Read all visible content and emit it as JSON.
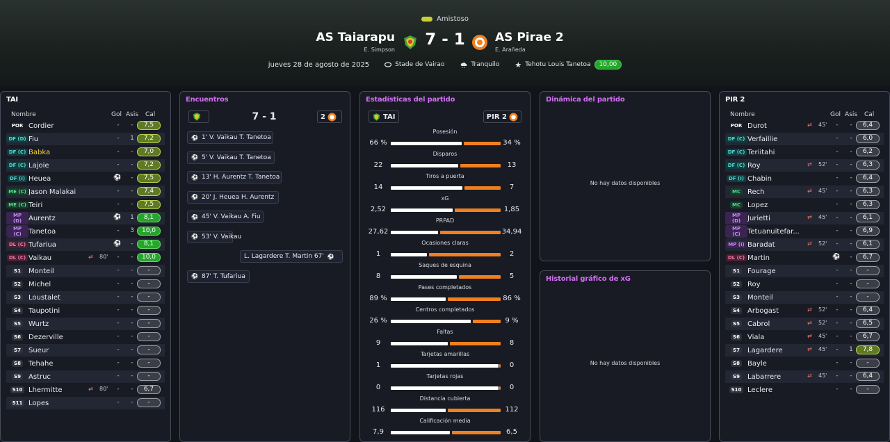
{
  "header": {
    "competition": "Amistoso",
    "home_team": "AS Taiarapu",
    "home_manager": "E. Simpson",
    "away_team": "AS Pirae 2",
    "away_manager": "E. Arañeda",
    "score": "7 - 1",
    "date": "jueves 28 de agosto de 2025",
    "stadium": "Stade de Vairao",
    "weather": "Tranquilo",
    "mvp": "Tehotu Louis Tanetoa",
    "mvp_rating": "10,00"
  },
  "home_panel": {
    "title": "TAI",
    "col_name": "Nombre",
    "col_goals": "Gol",
    "col_assists": "Asis",
    "col_rating": "Cal",
    "players": [
      {
        "pos": "POR",
        "name": "Cordier",
        "goals": "-",
        "assists": "-",
        "rating": "7,5",
        "sub": "",
        "ball": false
      },
      {
        "pos": "DF (D)",
        "name": "Fiu",
        "goals": "-",
        "assists": "1",
        "rating": "7,2",
        "sub": "",
        "ball": false
      },
      {
        "pos": "DF (C)",
        "name": "Babka",
        "goals": "-",
        "assists": "-",
        "rating": "7,0",
        "sub": "",
        "ball": false
      },
      {
        "pos": "DF (C)",
        "name": "Lajoie",
        "goals": "-",
        "assists": "-",
        "rating": "7,2",
        "sub": "",
        "ball": false
      },
      {
        "pos": "DF (I)",
        "name": "Heuea",
        "goals": "",
        "assists": "-",
        "rating": "7,5",
        "sub": "",
        "ball": true
      },
      {
        "pos": "ME (C)",
        "name": "Jason Malakai",
        "goals": "-",
        "assists": "-",
        "rating": "7,4",
        "sub": "",
        "ball": false
      },
      {
        "pos": "ME (C)",
        "name": "Teiri",
        "goals": "-",
        "assists": "-",
        "rating": "7,5",
        "sub": "",
        "ball": false
      },
      {
        "pos": "MP (D)",
        "name": "Aurentz",
        "goals": "",
        "assists": "1",
        "rating": "8,1",
        "sub": "",
        "ball": true
      },
      {
        "pos": "MP (C)",
        "name": "Tanetoa",
        "goals": "-",
        "assists": "3",
        "rating": "10,0",
        "sub": "",
        "ball": false
      },
      {
        "pos": "DL (C)",
        "name": "Tufariua",
        "goals": "",
        "assists": "-",
        "rating": "8,1",
        "sub": "",
        "ball": true
      },
      {
        "pos": "DL (C)",
        "name": "Vaikau",
        "goals": "-",
        "assists": "-",
        "rating": "10,0",
        "sub": "80'",
        "ball": false
      },
      {
        "pos": "S1",
        "name": "Monteil",
        "goals": "-",
        "assists": "-",
        "rating": "-",
        "sub": "",
        "ball": false
      },
      {
        "pos": "S2",
        "name": "Michel",
        "goals": "-",
        "assists": "-",
        "rating": "-",
        "sub": "",
        "ball": false
      },
      {
        "pos": "S3",
        "name": "Loustalet",
        "goals": "-",
        "assists": "-",
        "rating": "-",
        "sub": "",
        "ball": false
      },
      {
        "pos": "S4",
        "name": "Taupotini",
        "goals": "-",
        "assists": "-",
        "rating": "-",
        "sub": "",
        "ball": false
      },
      {
        "pos": "S5",
        "name": "Wurtz",
        "goals": "-",
        "assists": "-",
        "rating": "-",
        "sub": "",
        "ball": false
      },
      {
        "pos": "S6",
        "name": "Dezerville",
        "goals": "-",
        "assists": "-",
        "rating": "-",
        "sub": "",
        "ball": false
      },
      {
        "pos": "S7",
        "name": "Sueur",
        "goals": "-",
        "assists": "-",
        "rating": "-",
        "sub": "",
        "ball": false
      },
      {
        "pos": "S8",
        "name": "Tehahe",
        "goals": "-",
        "assists": "-",
        "rating": "-",
        "sub": "",
        "ball": false
      },
      {
        "pos": "S9",
        "name": "Astruc",
        "goals": "-",
        "assists": "-",
        "rating": "-",
        "sub": "",
        "ball": false
      },
      {
        "pos": "S10",
        "name": "Lhermitte",
        "goals": "-",
        "assists": "-",
        "rating": "6,7",
        "sub": "80'",
        "ball": false
      },
      {
        "pos": "S11",
        "name": "Lopes",
        "goals": "-",
        "assists": "-",
        "rating": "-",
        "sub": "",
        "ball": false
      }
    ]
  },
  "away_panel": {
    "title": "PIR 2",
    "col_name": "Nombre",
    "col_goals": "Gol",
    "col_assists": "Asis",
    "col_rating": "Cal",
    "players": [
      {
        "pos": "POR",
        "name": "Durot",
        "goals": "-",
        "assists": "-",
        "rating": "6,4",
        "sub": "45'",
        "ball": false
      },
      {
        "pos": "DF (C)",
        "name": "Verfaillie",
        "goals": "-",
        "assists": "-",
        "rating": "6,0",
        "sub": "",
        "ball": false
      },
      {
        "pos": "DF (C)",
        "name": "Teriitahi",
        "goals": "-",
        "assists": "-",
        "rating": "6,2",
        "sub": "",
        "ball": false
      },
      {
        "pos": "DF (C)",
        "name": "Roy",
        "goals": "-",
        "assists": "-",
        "rating": "6,3",
        "sub": "52'",
        "ball": false
      },
      {
        "pos": "DF (I)",
        "name": "Chabin",
        "goals": "-",
        "assists": "-",
        "rating": "6,4",
        "sub": "",
        "ball": false
      },
      {
        "pos": "MC",
        "name": "Rech",
        "goals": "-",
        "assists": "-",
        "rating": "6,3",
        "sub": "45'",
        "ball": false
      },
      {
        "pos": "MC",
        "name": "Lopez",
        "goals": "-",
        "assists": "-",
        "rating": "6,3",
        "sub": "",
        "ball": false
      },
      {
        "pos": "MP (D)",
        "name": "Jurietti",
        "goals": "-",
        "assists": "-",
        "rating": "6,1",
        "sub": "45'",
        "ball": false
      },
      {
        "pos": "MP (C)",
        "name": "Tetuanuitefar...",
        "goals": "-",
        "assists": "-",
        "rating": "6,9",
        "sub": "",
        "ball": false
      },
      {
        "pos": "MP (I)",
        "name": "Baradat",
        "goals": "-",
        "assists": "-",
        "rating": "6,1",
        "sub": "52'",
        "ball": false
      },
      {
        "pos": "DL (C)",
        "name": "Martin",
        "goals": "",
        "assists": "-",
        "rating": "6,7",
        "sub": "",
        "ball": true
      },
      {
        "pos": "S1",
        "name": "Fourage",
        "goals": "-",
        "assists": "-",
        "rating": "-",
        "sub": "",
        "ball": false
      },
      {
        "pos": "S2",
        "name": "Roy",
        "goals": "-",
        "assists": "-",
        "rating": "-",
        "sub": "",
        "ball": false
      },
      {
        "pos": "S3",
        "name": "Monteil",
        "goals": "-",
        "assists": "-",
        "rating": "-",
        "sub": "",
        "ball": false
      },
      {
        "pos": "S4",
        "name": "Arbogast",
        "goals": "-",
        "assists": "-",
        "rating": "6,4",
        "sub": "52'",
        "ball": false
      },
      {
        "pos": "S5",
        "name": "Cabrol",
        "goals": "-",
        "assists": "-",
        "rating": "6,5",
        "sub": "52'",
        "ball": false
      },
      {
        "pos": "S6",
        "name": "Viala",
        "goals": "-",
        "assists": "-",
        "rating": "6,7",
        "sub": "45'",
        "ball": false
      },
      {
        "pos": "S7",
        "name": "Lagardere",
        "goals": "-",
        "assists": "1",
        "rating": "7,8",
        "sub": "45'",
        "ball": false
      },
      {
        "pos": "S8",
        "name": "Bayle",
        "goals": "-",
        "assists": "-",
        "rating": "-",
        "sub": "",
        "ball": false
      },
      {
        "pos": "S9",
        "name": "Labarrere",
        "goals": "-",
        "assists": "-",
        "rating": "6,4",
        "sub": "45'",
        "ball": false
      },
      {
        "pos": "S10",
        "name": "Leclere",
        "goals": "-",
        "assists": "-",
        "rating": "-",
        "sub": "",
        "ball": false
      }
    ]
  },
  "events_panel": {
    "title": "Encuentros",
    "score": "7 - 1",
    "away_goals": "2",
    "events": [
      {
        "side": "home",
        "text": "1'  V. Vaikau  T. Tanetoa"
      },
      {
        "side": "home",
        "text": "5'  V. Vaikau  T. Tanetoa"
      },
      {
        "side": "home",
        "text": "13'  H. Aurentz  T. Tanetoa"
      },
      {
        "side": "home",
        "text": "20'  J. Heuea  H. Aurentz"
      },
      {
        "side": "home",
        "text": "45'  V. Vaikau  A. Fiu"
      },
      {
        "side": "home",
        "text": "53'  V. Vaikau"
      },
      {
        "side": "away",
        "text": "L. Lagardere  T. Martin  67'"
      },
      {
        "side": "home",
        "text": "87'  T. Tufariua"
      }
    ]
  },
  "stats_panel": {
    "title": "Estadísticas del partido",
    "home_label": "TAI",
    "away_label": "PIR 2",
    "stats": [
      {
        "label": "Posesión",
        "home": "66 %",
        "away": "34 %",
        "h": 66,
        "a": 34
      },
      {
        "label": "Disparos",
        "home": "22",
        "away": "13",
        "h": 22,
        "a": 13
      },
      {
        "label": "Tiros a puerta",
        "home": "14",
        "away": "7",
        "h": 14,
        "a": 7
      },
      {
        "label": "xG",
        "home": "2,52",
        "away": "1,85",
        "h": 2.52,
        "a": 1.85
      },
      {
        "label": "PRPAD",
        "home": "27,62",
        "away": "34,94",
        "h": 27.62,
        "a": 34.94
      },
      {
        "label": "Ocasiones claras",
        "home": "1",
        "away": "2",
        "h": 1,
        "a": 2
      },
      {
        "label": "Saques de esquina",
        "home": "8",
        "away": "5",
        "h": 8,
        "a": 5
      },
      {
        "label": "Pases completados",
        "home": "89 %",
        "away": "86 %",
        "h": 89,
        "a": 86
      },
      {
        "label": "Centros completados",
        "home": "26 %",
        "away": "9 %",
        "h": 26,
        "a": 9
      },
      {
        "label": "Faltas",
        "home": "9",
        "away": "8",
        "h": 9,
        "a": 8
      },
      {
        "label": "Tarjetas amarillas",
        "home": "1",
        "away": "0",
        "h": 1,
        "a": 0
      },
      {
        "label": "Tarjetas rojas",
        "home": "0",
        "away": "0",
        "h": 0,
        "a": 0
      },
      {
        "label": "Distancia cubierta",
        "home": "116",
        "away": "112",
        "h": 116,
        "a": 112
      },
      {
        "label": "Calificación media",
        "home": "7,9",
        "away": "6,5",
        "h": 7.9,
        "a": 6.5
      }
    ]
  },
  "dynamics_panel": {
    "title": "Dinámica del partido",
    "empty": "No hay datos disponibles"
  },
  "xg_panel": {
    "title": "Historial gráfico de xG",
    "empty": "No hay datos disponibles"
  },
  "colors": {
    "accent_purple": "#d06ef2",
    "home_bar": "#ffffff",
    "away_bar": "#f0801f",
    "rating_high": "#26a52d",
    "rating_mid": "#5f7a23",
    "rating_low": "#3b3e47"
  }
}
